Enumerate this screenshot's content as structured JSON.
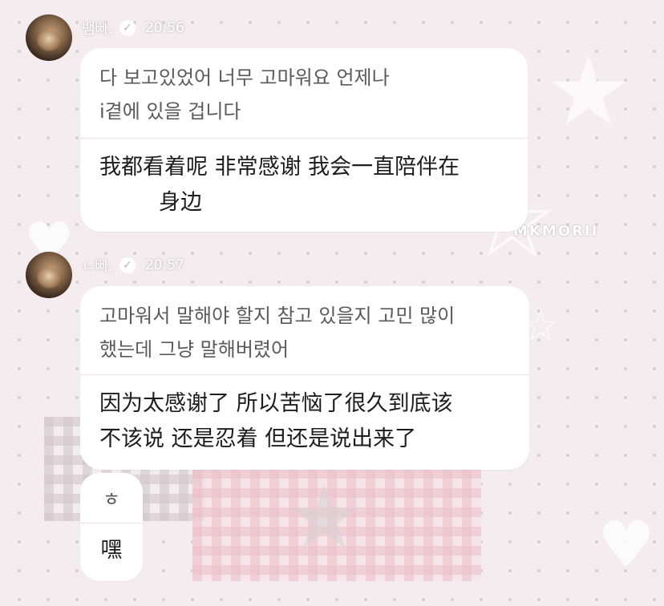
{
  "colors": {
    "background": "#f4ecee",
    "bubble": "#ffffff",
    "korean_text": "#5a5a5a",
    "chinese_text": "#1d1d1d"
  },
  "watermark": "MKMORII",
  "messages": [
    {
      "sender": "뱀빠.",
      "time": "20:56",
      "korean_lines": [
        "다 보고있었어 너무 고마워요 언제나",
        "i곁에 있을 겁니다"
      ],
      "chinese_lines": [
        "我都看着呢 非常感谢 我会一直陪伴在",
        "身边"
      ]
    },
    {
      "sender": "ㄴ빠.",
      "time": "20:57",
      "korean_lines": [
        "고마워서 말해야 할지 참고 있을지 고민 많이",
        "했는데 그냥 말해버렸어"
      ],
      "chinese_lines": [
        "因为太感谢了 所以苦恼了很久到底该",
        "不该说 还是忍着 但还是说出来了"
      ]
    },
    {
      "korean_lines": [
        "ㅎ"
      ],
      "chinese_lines": [
        "嘿"
      ]
    }
  ]
}
